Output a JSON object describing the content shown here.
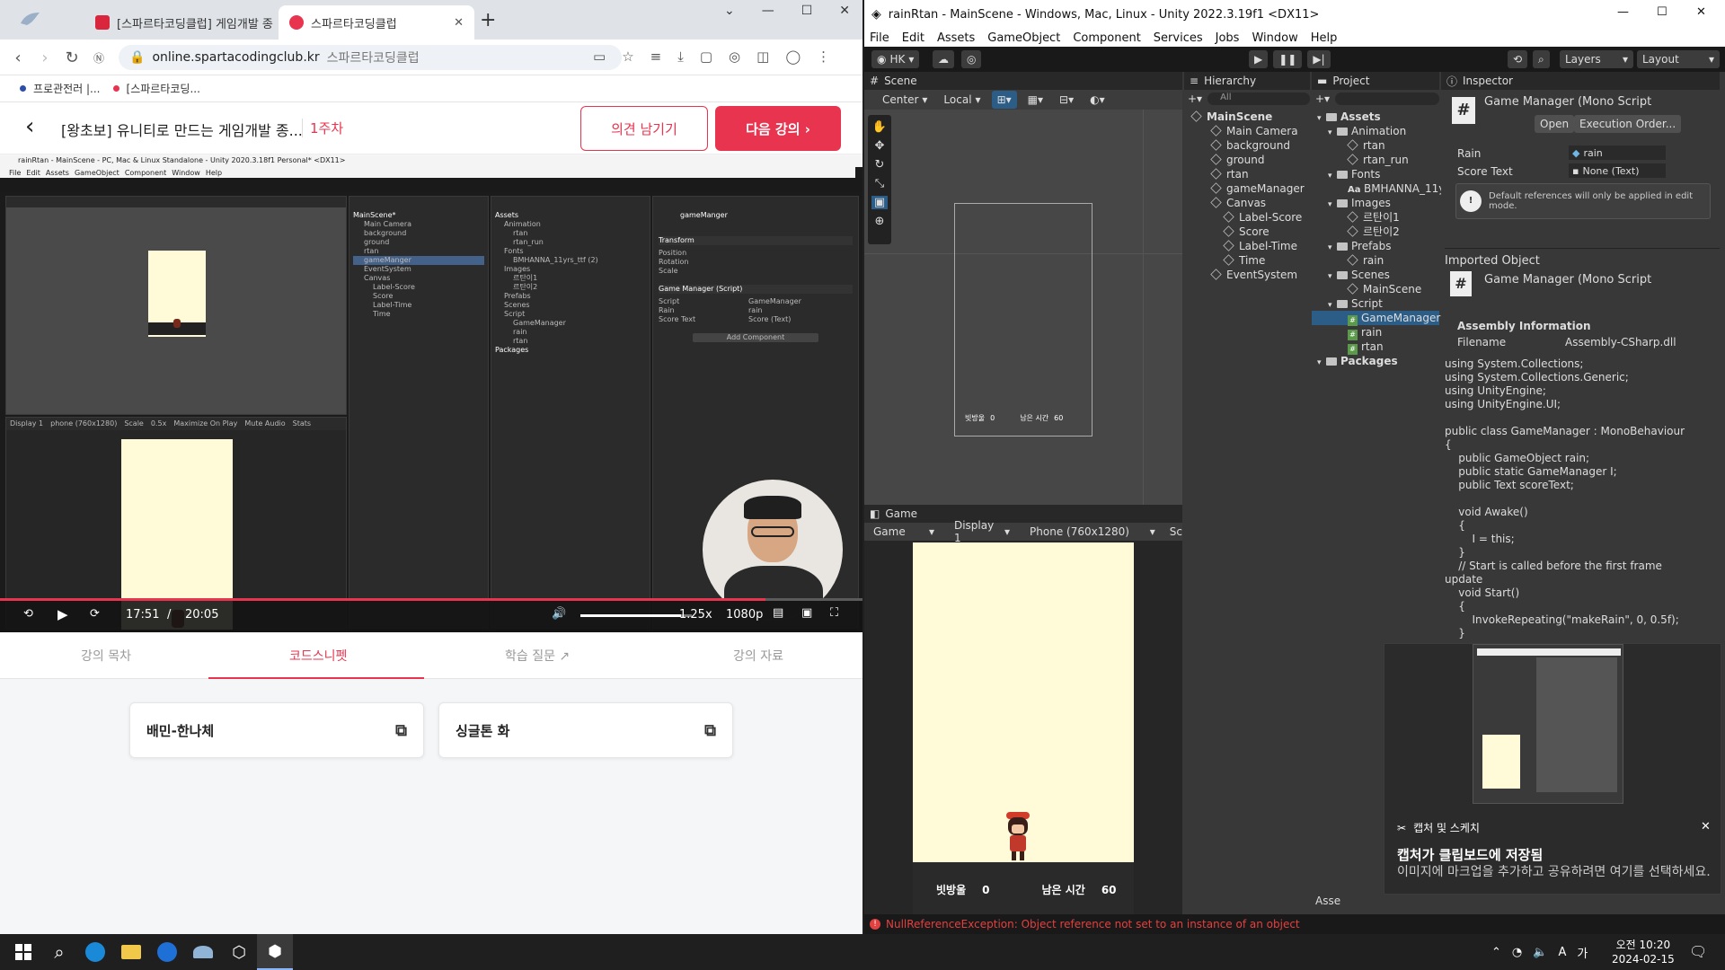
{
  "browser": {
    "tabs": [
      {
        "title": "[스파르타코딩클럽] 게임개발 종",
        "active": false
      },
      {
        "title": "스파르타코딩클럽",
        "active": true
      }
    ],
    "new_tab": "+",
    "url": "online.spartacodingclub.kr",
    "url_site": "스파르타코딩클럽",
    "bookmarks": [
      "프로관전러 |...",
      "[스파르타코딩..."
    ],
    "course_title": "[왕초보] 유니티로 만드는 게임개발 종...",
    "course_week": "1주차",
    "feedback_button": "의견 남기기",
    "next_button": "다음 강의 ›",
    "video": {
      "time_current": "17:51",
      "time_separator": "/",
      "time_total": "20:05",
      "speed": "1.25x",
      "quality": "1080p",
      "progress": 0.888,
      "volume": 0.9,
      "inner_title": "rainRtan - MainScene - PC, Mac & Linux Standalone - Unity 2020.3.18f1 Personal* <DX11>",
      "inner_menu": [
        "File",
        "Edit",
        "Assets",
        "GameObject",
        "Component",
        "Window",
        "Help"
      ],
      "inner_hierarchy": [
        "MainScene*",
        "Main Camera",
        "background",
        "ground",
        "rtan",
        "gameManger",
        "EventSystem",
        "Canvas",
        "Label-Score",
        "Score",
        "Label-Time",
        "Time"
      ],
      "inner_project": [
        "Assets",
        "Animation",
        "rtan",
        "rtan_run",
        "Fonts",
        "BMHANNA_11yrs_ttf (2)",
        "Images",
        "르탄이1",
        "르탄이2",
        "Prefabs",
        "Scenes",
        "Script",
        "GameManager",
        "rain",
        "rtan",
        "Packages"
      ],
      "inner_inspector": {
        "object": "gameManger",
        "component": "Game Manager (Script)",
        "fields": [
          "Script",
          "Rain",
          "Score Text"
        ],
        "values": [
          "GameManager",
          "rain",
          "Score (Text)"
        ],
        "add_component": "Add Component",
        "transform": "Transform",
        "rows": [
          "Position",
          "Rotation",
          "Scale"
        ]
      },
      "inner_game_bar": [
        "Display 1",
        "phone (760x1280)",
        "Scale",
        "0.5x",
        "Maximize On Play",
        "Mute Audio",
        "Stats"
      ]
    },
    "lecture_tabs": [
      "강의 목차",
      "코드스니펫",
      "학습 질문 ↗",
      "강의 자료"
    ],
    "active_lecture_tab": 1,
    "snippets": [
      "배민-한나체",
      "싱글톤 화"
    ]
  },
  "unity": {
    "title": "rainRtan - MainScene - Windows, Mac, Linux - Unity 2022.3.19f1 <DX11>",
    "menu": [
      "File",
      "Edit",
      "Assets",
      "GameObject",
      "Component",
      "Services",
      "Jobs",
      "Window",
      "Help"
    ],
    "toolbar": {
      "account": "HK",
      "layers": "Layers",
      "layout": "Layout"
    },
    "scene_tab": "Scene",
    "scene_pivot": "Center",
    "scene_space": "Local",
    "scene_hud": {
      "score_label": "빗방울",
      "score": "0",
      "time_label": "남은 시간",
      "time": "60"
    },
    "hierarchy_tab": "Hierarchy",
    "hierarchy_search": "All",
    "hierarchy": [
      {
        "name": "MainScene",
        "depth": 0,
        "root": true
      },
      {
        "name": "Main Camera",
        "depth": 1
      },
      {
        "name": "background",
        "depth": 1
      },
      {
        "name": "ground",
        "depth": 1
      },
      {
        "name": "rtan",
        "depth": 1
      },
      {
        "name": "gameManager",
        "depth": 1
      },
      {
        "name": "Canvas",
        "depth": 1
      },
      {
        "name": "Label-Score",
        "depth": 2
      },
      {
        "name": "Score",
        "depth": 2
      },
      {
        "name": "Label-Time",
        "depth": 2
      },
      {
        "name": "Time",
        "depth": 2
      },
      {
        "name": "EventSystem",
        "depth": 1
      }
    ],
    "project_tab": "Project",
    "project": [
      {
        "name": "Assets",
        "depth": 0,
        "type": "folder"
      },
      {
        "name": "Animation",
        "depth": 1,
        "type": "folder"
      },
      {
        "name": "rtan",
        "depth": 2,
        "type": "file"
      },
      {
        "name": "rtan_run",
        "depth": 2,
        "type": "file"
      },
      {
        "name": "Fonts",
        "depth": 1,
        "type": "folder"
      },
      {
        "name": "BMHANNA_11y",
        "depth": 2,
        "type": "font"
      },
      {
        "name": "Images",
        "depth": 1,
        "type": "folder"
      },
      {
        "name": "르탄이1",
        "depth": 2,
        "type": "file"
      },
      {
        "name": "르탄이2",
        "depth": 2,
        "type": "file"
      },
      {
        "name": "Prefabs",
        "depth": 1,
        "type": "folder"
      },
      {
        "name": "rain",
        "depth": 2,
        "type": "file"
      },
      {
        "name": "Scenes",
        "depth": 1,
        "type": "folder"
      },
      {
        "name": "MainScene",
        "depth": 2,
        "type": "file"
      },
      {
        "name": "Script",
        "depth": 1,
        "type": "folder"
      },
      {
        "name": "GameManager",
        "depth": 2,
        "type": "script",
        "selected": true
      },
      {
        "name": "rain",
        "depth": 2,
        "type": "script"
      },
      {
        "name": "rtan",
        "depth": 2,
        "type": "script"
      },
      {
        "name": "Packages",
        "depth": 0,
        "type": "folder"
      }
    ],
    "project_footer": "Asse",
    "inspector": {
      "tab": "Inspector",
      "header": "Game Manager (Mono Script",
      "open": "Open",
      "execution_order": "Execution Order...",
      "rain_label": "Rain",
      "rain_value": "rain",
      "score_text_label": "Score Text",
      "score_text_value": "None (Text)",
      "info": "Default references will only be applied in edit mode.",
      "imported_object": "Imported Object",
      "imported_header": "Game Manager (Mono Script",
      "assembly_info": "Assembly Information",
      "filename_label": "Filename",
      "filename_value": "Assembly-CSharp.dll",
      "code": "using System.Collections;\nusing System.Collections.Generic;\nusing UnityEngine;\nusing UnityEngine.UI;\n\npublic class GameManager : MonoBehaviour\n{\n    public GameObject rain;\n    public static GameManager I;\n    public Text scoreText;\n\n    void Awake()\n    {\n        I = this;\n    }\n    // Start is called before the first frame\nupdate\n    void Start()\n    {\n        InvokeRepeating(\"makeRain\", 0, 0.5f);\n    }"
    },
    "game_tab": "Game",
    "game_bar": {
      "mode": "Game",
      "display": "Display 1",
      "resolution": "Phone (760x1280)",
      "extra": "Sc"
    },
    "game_hud": {
      "score_label": "빗방울",
      "score": "0",
      "time_label": "남은 시간",
      "time": "60"
    },
    "status_error": "NullReferenceException: Object reference not set to an instance of an object"
  },
  "notification": {
    "app": "캡처 및 스케치",
    "title": "캡처가 클립보드에 저장됨",
    "body": "이미지에 마크업을 추가하고 공유하려면 여기를 선택하세요."
  },
  "taskbar": {
    "time": "오전 10:20",
    "date": "2024-02-15",
    "ime": "A",
    "ime2": "가"
  },
  "colors": {
    "brand": "#e8344e",
    "unity_dark": "#383838",
    "game_bg": "#fffbd8",
    "error": "#e34040"
  }
}
